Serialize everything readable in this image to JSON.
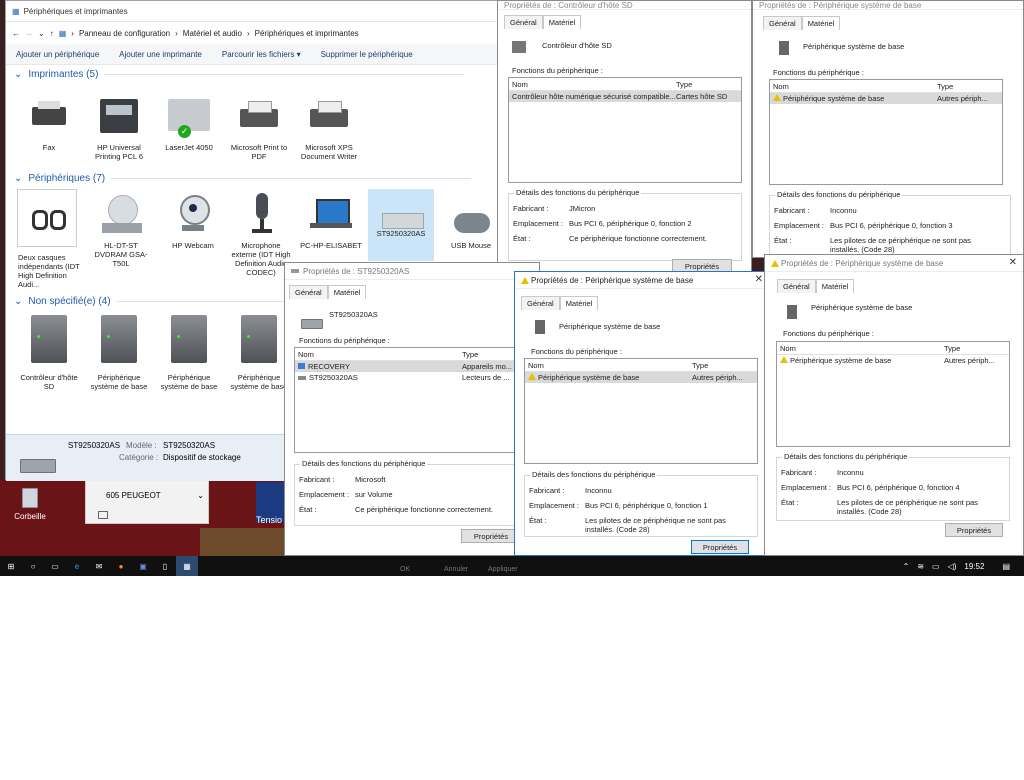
{
  "main": {
    "title": "Périphériques et imprimantes",
    "breadcrumb": [
      "Panneau de configuration",
      "Matériel et audio",
      "Périphériques et imprimantes"
    ],
    "commands": [
      "Ajouter un périphérique",
      "Ajouter une imprimante",
      "Parcourir les fichiers ▾",
      "Supprimer le périphérique"
    ],
    "groups": {
      "printers": "Imprimantes (5)",
      "devices": "Périphériques (7)",
      "unspecified": "Non spécifié(e) (4)"
    },
    "printers": [
      "Fax",
      "HP Universal Printing PCL 6",
      "LaserJet 4050",
      "Microsoft Print to PDF",
      "Microsoft XPS Document Writer"
    ],
    "devices": [
      "Deux casques indépendants (IDT High Definition Audi...",
      "HL-DT-ST DVDRAM GSA-T50L",
      "HP Webcam",
      "Microphone externe (IDT High Definition Audio CODEC)",
      "PC-HP-ELISABET",
      "ST9250320AS",
      "USB Mouse"
    ],
    "unspecified": [
      "Contrôleur d'hôte SD",
      "Périphérique système de base",
      "Périphérique système de base",
      "Périphérique système de base"
    ],
    "status": {
      "name": "ST9250320AS",
      "model_label": "Modèle :",
      "model_value": "ST9250320AS",
      "category_label": "Catégorie :",
      "category_value": "Dispositif de stockage"
    }
  },
  "desktop": {
    "recycle": "Corbeille",
    "snippet": "605 PEUGEOT",
    "tension": "Tensio"
  },
  "labels": {
    "general": "Général",
    "hardware": "Matériel",
    "functions": "Fonctions du périphérique :",
    "col_name": "Nom",
    "col_type": "Type",
    "details": "Détails des fonctions du périphérique",
    "manufacturer": "Fabricant :",
    "location": "Emplacement :",
    "state": "État :",
    "properties_btn": "Propriétés",
    "ok": "OK",
    "cancel": "Annuler",
    "apply": "Appliquer"
  },
  "dialogs": {
    "sd": {
      "title": "Propriétés de : Contrôleur d'hôte SD",
      "device": "Contrôleur d'hôte SD",
      "row_name": "Contrôleur hôte numérique sécurisé compatible...",
      "row_type": "Cartes hôte SD",
      "manufacturer": "JMicron",
      "location": "Bus PCI 6, périphérique 0, fonction 2",
      "state": "Ce périphérique fonctionne correctement."
    },
    "base3": {
      "title": "Propriétés de : Périphérique système de base",
      "device": "Périphérique système de base",
      "row_name": "Périphérique système de base",
      "row_type": "Autres périph...",
      "manufacturer": "Inconnu",
      "location": "Bus PCI 6, périphérique 0, fonction 3",
      "state": "Les pilotes de ce périphérique ne sont pas installés. (Code 28)"
    },
    "disk": {
      "title": "Propriétés de : ST9250320AS",
      "device": "ST9250320AS",
      "rows": [
        {
          "name": "RECOVERY",
          "type": "Appareils mo..."
        },
        {
          "name": "ST9250320AS",
          "type": "Lecteurs de ..."
        }
      ],
      "manufacturer": "Microsoft",
      "location": "sur Volume",
      "state": "Ce périphérique fonctionne correctement."
    },
    "base1": {
      "title": "Propriétés de : Périphérique système de base",
      "device": "Périphérique système de base",
      "row_name": "Périphérique système de base",
      "row_type": "Autres périph...",
      "manufacturer": "Inconnu",
      "location": "Bus PCI 6, périphérique 0, fonction 1",
      "state": "Les pilotes de ce périphérique ne sont pas installés. (Code 28)"
    },
    "base4": {
      "title": "Propriétés de : Périphérique système de base",
      "device": "Périphérique système de base",
      "row_name": "Périphérique système de base",
      "row_type": "Autres périph...",
      "manufacturer": "Inconnu",
      "location": "Bus PCI 6, périphérique 0, fonction 4",
      "state": "Les pilotes de ce périphérique ne sont pas installés. (Code 28)"
    }
  },
  "taskbar": {
    "time": "19:52"
  }
}
